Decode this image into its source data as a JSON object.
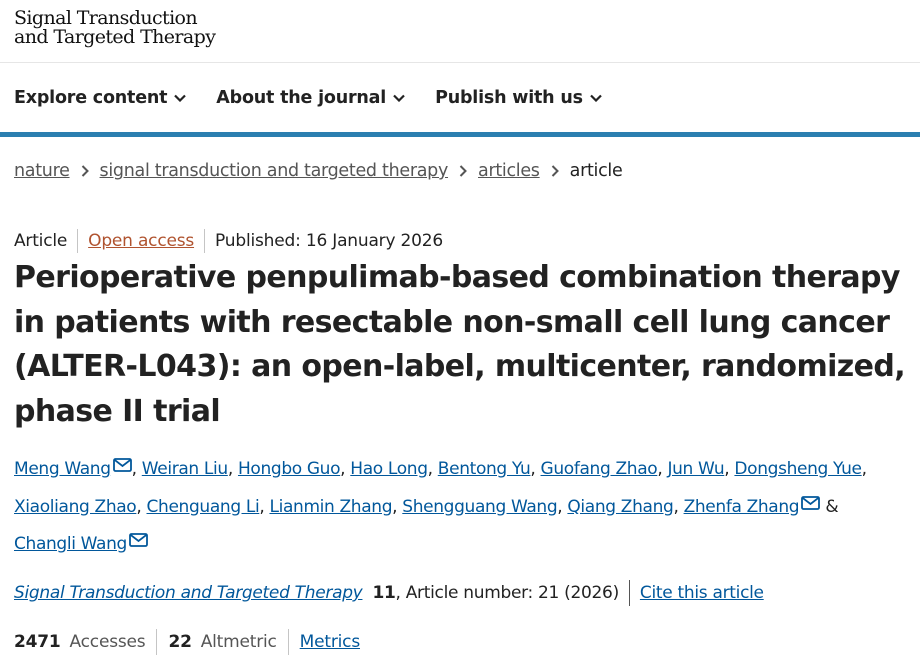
{
  "logo": {
    "line1": "Signal Transduction",
    "line2": "and Targeted Therapy"
  },
  "nav": [
    {
      "label": "Explore content"
    },
    {
      "label": "About the journal"
    },
    {
      "label": "Publish with us"
    }
  ],
  "breadcrumb": {
    "items": [
      "nature",
      "signal transduction and targeted therapy",
      "articles"
    ],
    "current": "article"
  },
  "article": {
    "type": "Article",
    "access": "Open access",
    "published": "Published: 16 January 2026",
    "title": "Perioperative penpulimab-based combination therapy in patients with resectable non-small cell lung cancer (ALTER-L043): an open-label, multicenter, randomized, phase II trial"
  },
  "authors": [
    "Meng Wang",
    "Weiran Liu",
    "Hongbo Guo",
    "Hao Long",
    "Bentong Yu",
    "Guofang Zhao",
    "Jun Wu",
    "Dongsheng Yue",
    "Xiaoliang Zhao",
    "Chenguang Li",
    "Lianmin Zhang",
    "Shengguang Wang",
    "Qiang Zhang",
    "Zhenfa Zhang",
    "Changli Wang"
  ],
  "authors_and": "&",
  "journal": {
    "name": "Signal Transduction and Targeted Therapy",
    "volume": "11",
    "article_number": ", Article number: 21 (2026)",
    "cite": "Cite this article"
  },
  "metrics": {
    "accesses_value": "2471",
    "accesses_label": "Accesses",
    "altmetric_value": "22",
    "altmetric_label": "Altmetric",
    "link": "Metrics"
  },
  "colors": {
    "link": "#01579b",
    "open_access": "#b0532f",
    "nav_border": "#2b7fb0"
  },
  "icons": {
    "nav": "chevron-down-icon",
    "breadcrumb": "chevron-right-icon",
    "author": "envelope-icon"
  }
}
